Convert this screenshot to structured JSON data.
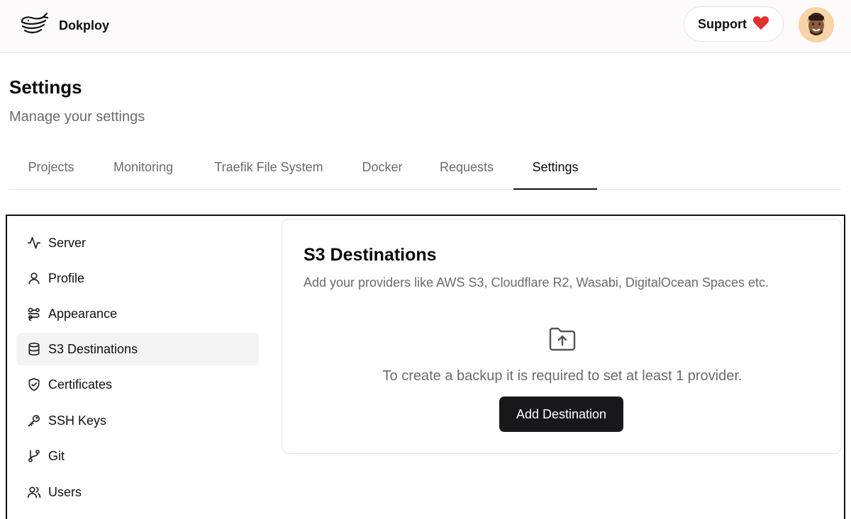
{
  "header": {
    "brand_name": "Dokploy",
    "support_label": "Support",
    "logo_icon": "whale-logo-icon",
    "heart_icon": "heart-icon",
    "heart_color": "#e03131"
  },
  "page": {
    "title": "Settings",
    "subtitle": "Manage your settings"
  },
  "tabs": [
    {
      "label": "Projects"
    },
    {
      "label": "Monitoring"
    },
    {
      "label": "Traefik File System"
    },
    {
      "label": "Docker"
    },
    {
      "label": "Requests"
    },
    {
      "label": "Settings",
      "active": true
    }
  ],
  "sidebar": {
    "items": [
      {
        "label": "Server",
        "icon": "activity-icon"
      },
      {
        "label": "Profile",
        "icon": "user-icon"
      },
      {
        "label": "Appearance",
        "icon": "palette-icon"
      },
      {
        "label": "S3 Destinations",
        "icon": "database-icon",
        "active": true
      },
      {
        "label": "Certificates",
        "icon": "shield-check-icon"
      },
      {
        "label": "SSH Keys",
        "icon": "key-icon"
      },
      {
        "label": "Git",
        "icon": "git-branch-icon"
      },
      {
        "label": "Users",
        "icon": "users-icon"
      }
    ]
  },
  "s3": {
    "title": "S3 Destinations",
    "description": "Add your providers like AWS S3, Cloudflare R2, Wasabi, DigitalOcean Spaces etc.",
    "empty_icon": "folder-up-icon",
    "empty_text": "To create a backup it is required to set at least 1 provider.",
    "add_button_label": "Add Destination"
  }
}
